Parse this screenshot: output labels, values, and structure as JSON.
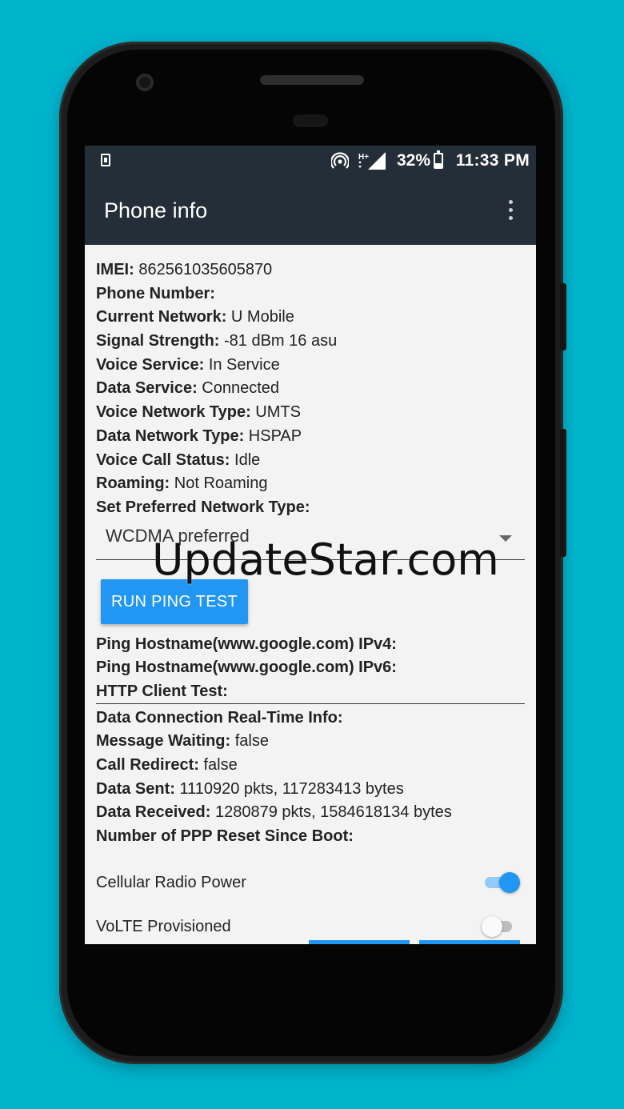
{
  "statusbar": {
    "battery_pct": "32%",
    "battery_level": 0.32,
    "time": "11:33 PM",
    "network_badge": "H+"
  },
  "appbar": {
    "title": "Phone info"
  },
  "info": [
    {
      "key": "IMEI:",
      "value": " 862561035605870"
    },
    {
      "key": "Phone Number:",
      "value": ""
    },
    {
      "key": "Current Network:",
      "value": " U Mobile"
    },
    {
      "key": "Signal Strength:",
      "value": " -81 dBm   16 asu"
    },
    {
      "key": "Voice Service:",
      "value": " In Service"
    },
    {
      "key": "Data Service:",
      "value": " Connected"
    },
    {
      "key": "Voice Network Type:",
      "value": " UMTS"
    },
    {
      "key": "Data Network Type:",
      "value": " HSPAP"
    },
    {
      "key": "Voice Call Status:",
      "value": " Idle"
    },
    {
      "key": "Roaming:",
      "value": " Not Roaming"
    },
    {
      "key": "Set Preferred Network Type:",
      "value": ""
    }
  ],
  "preferred_network": {
    "selected": "WCDMA preferred"
  },
  "ping_button": "RUN PING TEST",
  "ping_rows": [
    {
      "key": "Ping Hostname(www.google.com) IPv4:",
      "value": ""
    },
    {
      "key": "Ping Hostname(www.google.com) IPv6:",
      "value": ""
    },
    {
      "key": "HTTP Client Test:",
      "value": ""
    }
  ],
  "realtime": [
    {
      "key": "Data Connection Real-Time Info:",
      "value": ""
    },
    {
      "key": "Message Waiting:",
      "value": " false"
    },
    {
      "key": "Call Redirect:",
      "value": " false"
    },
    {
      "key": "Data Sent:",
      "value": " 1110920 pkts, 117283413 bytes"
    },
    {
      "key": "Data Received:",
      "value": " 1280879 pkts, 1584618134 bytes"
    },
    {
      "key": "Number of PPP Reset Since Boot:",
      "value": ""
    }
  ],
  "toggles": [
    {
      "label": "Cellular Radio Power",
      "on": true
    },
    {
      "label": "VoLTE Provisioned",
      "on": false
    }
  ],
  "watermark": "UpdateStar.com",
  "colors": {
    "background": "#00b3cc",
    "appbar": "#242e38",
    "accent": "#2196f3"
  }
}
